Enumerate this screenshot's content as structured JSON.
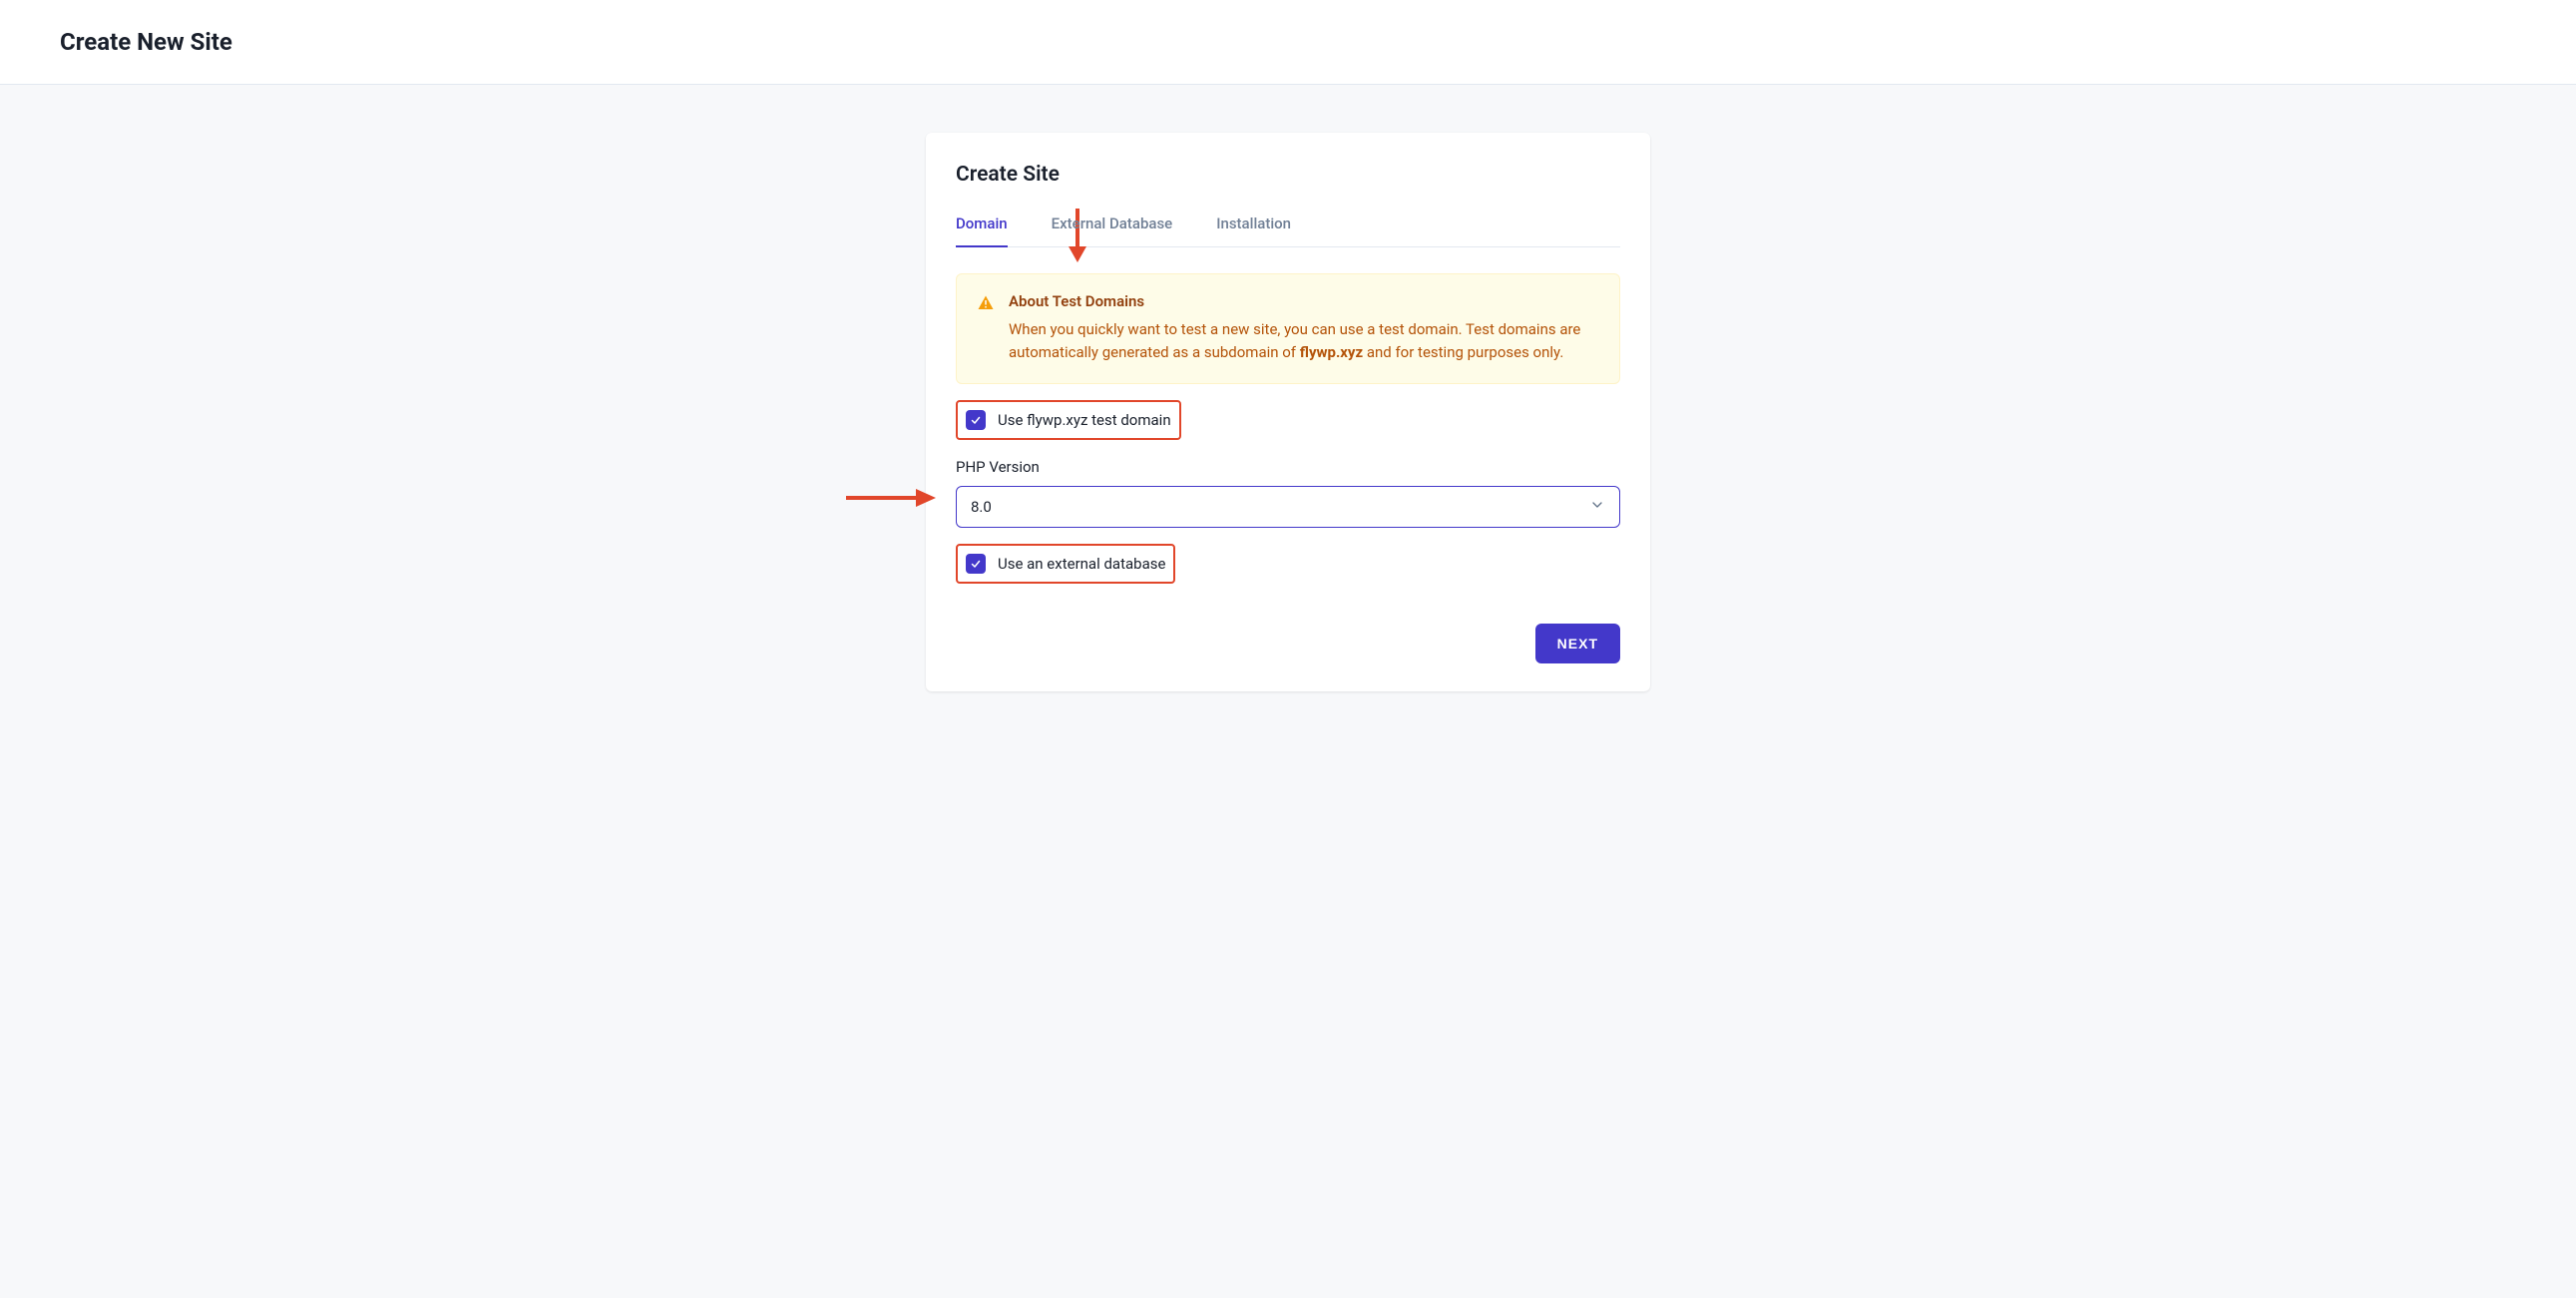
{
  "header": {
    "page_title": "Create New Site"
  },
  "card": {
    "title": "Create Site",
    "tabs": {
      "domain": "Domain",
      "external_database": "External Database",
      "installation": "Installation"
    },
    "info": {
      "title": "About Test Domains",
      "body_pre": "When you quickly want to test a new site, you can use a test domain. Test domains are automatically generated as a subdomain of ",
      "body_bold": "flywp.xyz",
      "body_post": " and for testing purposes only."
    },
    "checkbox_test_domain": "Use flywp.xyz test domain",
    "php_version_label": "PHP Version",
    "php_version_value": "8.0",
    "checkbox_external_db": "Use an external database",
    "next_button": "NEXT"
  }
}
